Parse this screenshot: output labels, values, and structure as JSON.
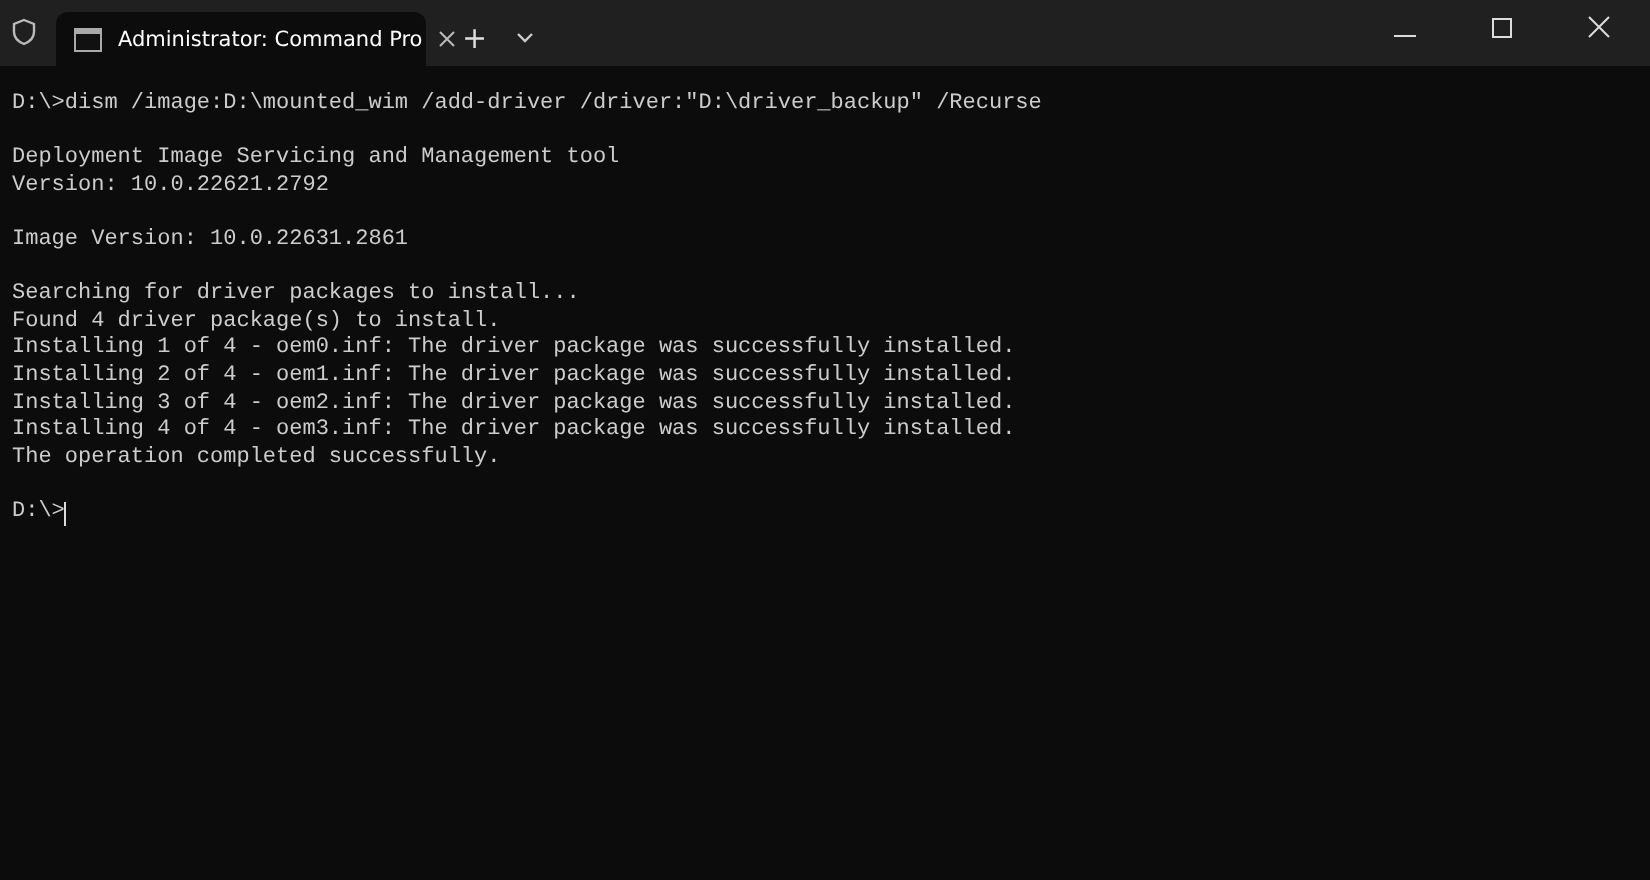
{
  "window": {
    "tab_title": "Administrator: Command Pro",
    "new_tab": "+"
  },
  "terminal": {
    "blocks": [
      {
        "kind": "output",
        "lines": [
          "D:\\>dism /image:D:\\mounted_wim /add-driver /driver:\"D:\\driver_backup\" /Recurse"
        ]
      },
      {
        "kind": "output",
        "lines": [
          "Deployment Image Servicing and Management tool",
          "Version: 10.0.22621.2792"
        ]
      },
      {
        "kind": "output",
        "lines": [
          "Image Version: 10.0.22631.2861"
        ]
      },
      {
        "kind": "output",
        "lines": [
          "Searching for driver packages to install...",
          "Found 4 driver package(s) to install.",
          "Installing 1 of 4 - oem0.inf: The driver package was successfully installed.",
          "Installing 2 of 4 - oem1.inf: The driver package was successfully installed.",
          "Installing 3 of 4 - oem2.inf: The driver package was successfully installed.",
          "Installing 4 of 4 - oem3.inf: The driver package was successfully installed.",
          "The operation completed successfully."
        ]
      },
      {
        "kind": "prompt",
        "lines": [
          "D:\\>"
        ]
      }
    ]
  }
}
